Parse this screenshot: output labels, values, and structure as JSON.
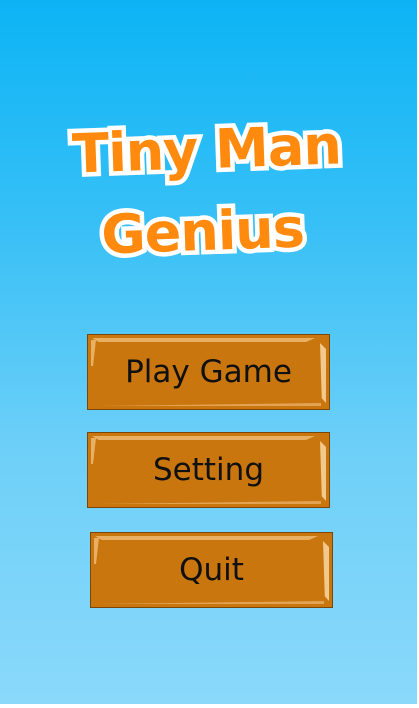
{
  "game": {
    "title_line_1": "Tiny Man",
    "title_line_2": "Genius"
  },
  "menu": {
    "items": [
      {
        "label": "Play Game"
      },
      {
        "label": "Setting"
      },
      {
        "label": "Quit"
      }
    ]
  },
  "colors": {
    "background_top": "#0cb4f5",
    "background_bottom": "#8ad9fb",
    "title_fill": "#ff8a0d",
    "title_outline": "#ffffff",
    "button_wood": "#c9760f",
    "button_highlight": "#f2c98c"
  }
}
